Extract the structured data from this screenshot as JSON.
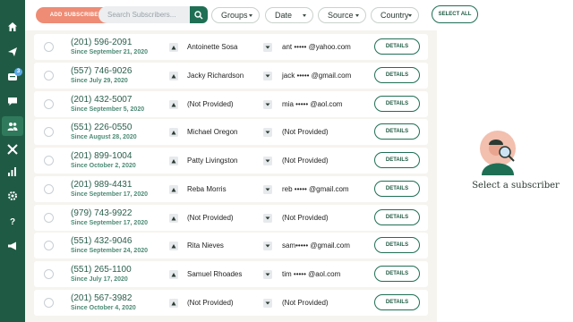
{
  "toolbar": {
    "add_label": "ADD SUBSCRIBER",
    "search_placeholder": "Search Subscribers...",
    "filters": [
      "Groups",
      "Date",
      "Source",
      "Country"
    ],
    "select_all_label": "SELECT ALL"
  },
  "sidebar": {
    "items": [
      {
        "icon": "home-icon"
      },
      {
        "icon": "send-icon"
      },
      {
        "icon": "inbox-icon",
        "badge": "3"
      },
      {
        "icon": "chat-icon"
      },
      {
        "icon": "subscribers-icon",
        "active": true
      },
      {
        "icon": "automation-icon"
      },
      {
        "icon": "analytics-icon"
      },
      {
        "icon": "settings-icon"
      },
      {
        "icon": "help-icon"
      },
      {
        "icon": "megaphone-icon"
      }
    ]
  },
  "subscribers": [
    {
      "phone": "(201) 596-2091",
      "since": "Since September 21, 2020",
      "name": "Antoinette Sosa",
      "email": "ant ••••• @yahoo.com",
      "details": "DETAILS"
    },
    {
      "phone": "(557) 746-9026",
      "since": "Since July 29, 2020",
      "name": "Jacky Richardson",
      "email": "jack ••••• @gmail.com",
      "details": "DETAILS"
    },
    {
      "phone": "(201) 432-5007",
      "since": "Since September 5, 2020",
      "name": "(Not Provided)",
      "email": "mia ••••• @aol.com",
      "details": "DETAILS"
    },
    {
      "phone": "(551) 226-0550",
      "since": "Since August 28, 2020",
      "name": "Michael Oregon",
      "email": "(Not Provided)",
      "details": "DETAILS"
    },
    {
      "phone": "(201) 899-1004",
      "since": "Since October 2, 2020",
      "name": "Patty Livingston",
      "email": "(Not Provided)",
      "details": "DETAILS"
    },
    {
      "phone": "(201) 989-4431",
      "since": "Since September 17, 2020",
      "name": "Reba Morris",
      "email": "reb ••••• @gmail.com",
      "details": "DETAILS"
    },
    {
      "phone": "(979) 743-9922",
      "since": "Since September 17, 2020",
      "name": "(Not Provided)",
      "email": "(Not Provided)",
      "details": "DETAILS"
    },
    {
      "phone": "(551) 432-9046",
      "since": "Since September 24, 2020",
      "name": "Rita Nieves",
      "email": "sam••••• @gmail.com",
      "details": "DETAILS"
    },
    {
      "phone": "(551) 265-1100",
      "since": "Since July 17, 2020",
      "name": "Samuel Rhoades",
      "email": "tim ••••• @aol.com",
      "details": "DETAILS"
    },
    {
      "phone": "(201) 567-3982",
      "since": "Since October 4, 2020",
      "name": "(Not Provided)",
      "email": "(Not Provided)",
      "details": "DETAILS"
    }
  ],
  "panel": {
    "empty_text": "Select a subscriber"
  },
  "colors": {
    "sidebar": "#1f5b44",
    "accent": "#1f6f55",
    "add_button": "#ee8c75"
  }
}
